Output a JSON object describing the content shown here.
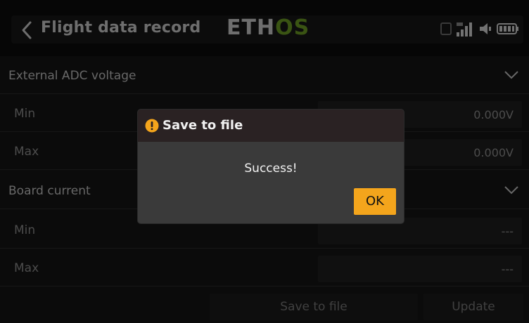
{
  "header": {
    "title": "Flight data record",
    "logo_main": "ETH",
    "logo_accent": "OS",
    "accent_color": "#6b9a24"
  },
  "sections": [
    {
      "label": "External ADC voltage",
      "rows": [
        {
          "label": "Min",
          "value": "0.000V"
        },
        {
          "label": "Max",
          "value": "0.000V"
        }
      ]
    },
    {
      "label": "Board current",
      "rows": [
        {
          "label": "Min",
          "value": "---"
        },
        {
          "label": "Max",
          "value": "---"
        }
      ]
    }
  ],
  "footer": {
    "save_label": "Save to file",
    "update_label": "Update"
  },
  "dialog": {
    "title": "Save to file",
    "message": "Success!",
    "ok_label": "OK",
    "ok_color": "#f4a51c"
  },
  "icons": [
    "back-arrow-icon",
    "chevron-down-icon",
    "warning-icon",
    "sd-card-icon",
    "signal-icon",
    "speaker-icon",
    "battery-icon"
  ]
}
